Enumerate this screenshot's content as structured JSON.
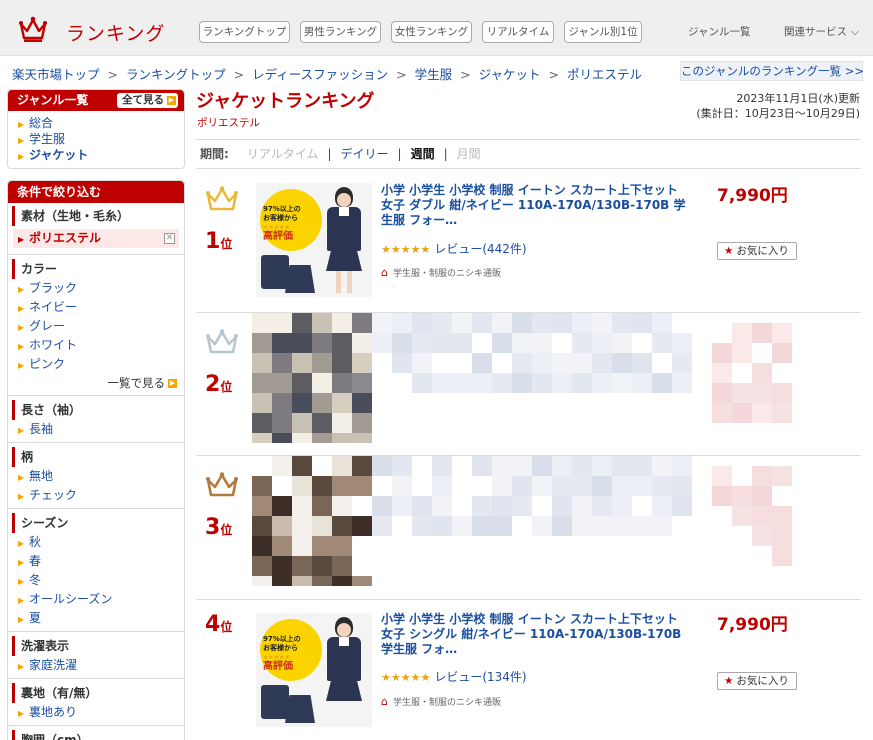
{
  "header": {
    "logo_text": "ランキング",
    "nav": [
      "ランキングトップ",
      "男性ランキング",
      "女性ランキング",
      "リアルタイム",
      "ジャンル別1位"
    ],
    "genre_list": "ジャンル一覧",
    "related": "関連サービス"
  },
  "breadcrumb": [
    "楽天市場トップ",
    "ランキングトップ",
    "レディースファッション",
    "学生服",
    "ジャケット",
    "ポリエステル"
  ],
  "genre_ranking_link": "このジャンルのランキング一覧 >>",
  "genre_box": {
    "title": "ジャンル一覧",
    "see_all": "全て見る",
    "items": [
      "総合",
      "学生服",
      "ジャケット"
    ]
  },
  "filter_box": {
    "title": "条件で絞り込む",
    "sections": [
      {
        "heading": "素材（生地・毛糸）",
        "selected": "ポリエステル"
      },
      {
        "heading": "カラー",
        "items": [
          "ブラック",
          "ネイビー",
          "グレー",
          "ホワイト",
          "ピンク"
        ],
        "more": "一覧で見る"
      },
      {
        "heading": "長さ（袖）",
        "items": [
          "長袖"
        ]
      },
      {
        "heading": "柄",
        "items": [
          "無地",
          "チェック"
        ]
      },
      {
        "heading": "シーズン",
        "items": [
          "秋",
          "春",
          "冬",
          "オールシーズン",
          "夏"
        ]
      },
      {
        "heading": "洗濯表示",
        "items": [
          "家庭洗濯"
        ]
      },
      {
        "heading": "裏地（有/無）",
        "items": [
          "裏地あり"
        ]
      },
      {
        "heading": "胸囲（cm）",
        "items": []
      }
    ]
  },
  "main": {
    "title": "ジャケットランキング",
    "subtitle": "ポリエステル",
    "updated_line1": "2023年11月1日(水)更新",
    "updated_line2": "(集計日：10月23日～10月29日)",
    "period_label": "期間:",
    "periods": [
      "リアルタイム",
      "デイリー",
      "週間",
      "月間"
    ]
  },
  "rankings": [
    {
      "rank": "1",
      "rank_suffix": "位",
      "title": "小学 小学生 小学校 制服 イートン スカート上下セット 女子 ダブル 紺/ネイビー 110A-170A/130B-170B 学生服 フォー…",
      "stars": "★★★★★",
      "review": "レビュー(442件)",
      "shop": "学生服・制服のニシキ通販",
      "price": "7,990円",
      "fav": "お気に入り",
      "thumb_text": [
        "97%以上の",
        "お客様から",
        "★★★★★",
        "高評価"
      ],
      "crown_color": "#e8b93a"
    },
    {
      "rank": "2",
      "rank_suffix": "位",
      "crown_color": "#b9c5cf"
    },
    {
      "rank": "3",
      "rank_suffix": "位",
      "crown_color": "#b07b3f"
    },
    {
      "rank": "4",
      "rank_suffix": "位",
      "title": "小学 小学生 小学校 制服 イートン スカート上下セット 女子 シングル 紺/ネイビー 110A-170A/130B-170B 学生服 フォ…",
      "stars": "★★★★★",
      "review": "レビュー(134件)",
      "shop": "学生服・制服のニシキ通販",
      "price": "7,990円",
      "fav": "お気に入り",
      "thumb_text": [
        "97%以上の",
        "お客様から",
        "★★★★★",
        "高評価"
      ]
    }
  ]
}
